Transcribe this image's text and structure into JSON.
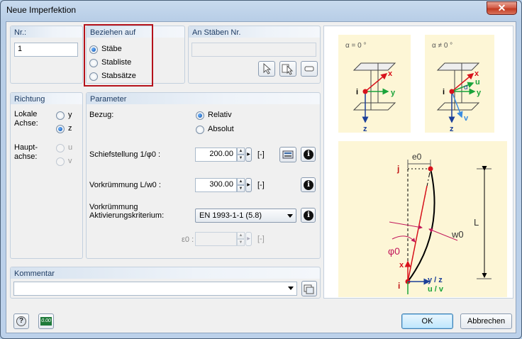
{
  "window": {
    "title": "Neue Imperfektion",
    "close_glyph": "✕"
  },
  "nr": {
    "label": "Nr.:",
    "value": "1"
  },
  "beziehen": {
    "label": "Beziehen auf",
    "options": [
      {
        "label": "Stäbe",
        "selected": true
      },
      {
        "label": "Stabliste",
        "selected": false
      },
      {
        "label": "Stabsätze",
        "selected": false
      }
    ]
  },
  "an_staeben": {
    "label": "An Stäben Nr.",
    "value": ""
  },
  "richtung": {
    "label": "Richtung",
    "lokale_achse": "Lokale\nAchse:",
    "lokale_label_1": "Lokale",
    "lokale_label_2": "Achse:",
    "haupt_label_1": "Haupt-",
    "haupt_label_2": "achse:",
    "y": "y",
    "z": "z",
    "u": "u",
    "v": "v"
  },
  "parameter": {
    "label": "Parameter",
    "bezug_label": "Bezug:",
    "relativ": "Relativ",
    "absolut": "Absolut",
    "schief_label": "Schiefstellung 1/φ0 :",
    "schief_value": "200.00",
    "unit_bracket": "[-]",
    "vork_label": "Vorkrümmung L/w0 :",
    "vork_value": "300.00",
    "akt_label_1": "Vorkrümmung",
    "akt_label_2": "Aktivierungskriterium:",
    "akt_value": "EN 1993-1-1 (5.8)",
    "eps_label": "ε0 :",
    "eps_value": "",
    "info_glyph": "i"
  },
  "kommentar": {
    "label": "Kommentar",
    "value": ""
  },
  "diagram": {
    "alpha0": "α = 0 °",
    "alpha_ne": "α ≠ 0 °",
    "x": "x",
    "y": "y",
    "z": "z",
    "u": "u",
    "v": "v",
    "i": "i",
    "j": "j",
    "alpha": "α",
    "e0": "e0",
    "w0": "w0",
    "phi0": "φ0",
    "L": "L",
    "yz": "y / z",
    "uv": "u / v"
  },
  "footer": {
    "ok": "OK",
    "cancel": "Abbrechen",
    "help_glyph": "?",
    "units_glyph": "0.00"
  },
  "colors": {
    "accent_red": "#b5121b",
    "diagram_bg": "#fdf6d6",
    "green": "#1aa33a",
    "blue": "#1b55c9"
  }
}
